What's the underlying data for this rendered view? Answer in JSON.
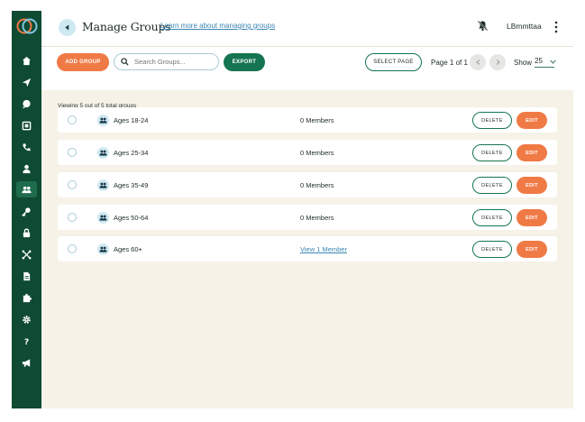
{
  "header": {
    "title": "Manage Groups",
    "help_link": "Learn more about managing groups",
    "username": "LBmmttaa"
  },
  "toolbar": {
    "add_label": "ADD GROUP",
    "search_placeholder": "Search Groups...",
    "export_label": "EXPORT",
    "select_page_label": "SELECT PAGE",
    "page_info": "Page 1 of 1",
    "show_label": "Show",
    "show_value": "25"
  },
  "count_text": "Viewing 5 out of 5 total groups",
  "groups": [
    {
      "name": "Ages 18-24",
      "members": "0 Members",
      "delete": "DELETE",
      "edit": "EDIT"
    },
    {
      "name": "Ages 25-34",
      "members": "0 Members",
      "delete": "DELETE",
      "edit": "EDIT"
    },
    {
      "name": "Ages 35-49",
      "members": "0 Members",
      "delete": "DELETE",
      "edit": "EDIT"
    },
    {
      "name": "Ages 50-64",
      "members": "0 Members",
      "delete": "DELETE",
      "edit": "EDIT"
    },
    {
      "name": "Ages 60+",
      "members": "View 1 Member",
      "delete": "DELETE",
      "edit": "EDIT"
    }
  ],
  "sidebar": {
    "items": [
      "home-icon",
      "send-icon",
      "chat-icon",
      "inbox-icon",
      "phone-icon",
      "user-icon",
      "groups-icon",
      "key-icon",
      "lock-icon",
      "network-icon",
      "document-icon",
      "puzzle-icon",
      "gear-icon",
      "help-icon",
      "megaphone-icon"
    ],
    "active": "groups-icon"
  },
  "colors": {
    "sidebar": "#0f4a33",
    "accent_orange": "#f07a45",
    "accent_green": "#157550",
    "background": "#f6f2e8",
    "link": "#3c86b4"
  }
}
